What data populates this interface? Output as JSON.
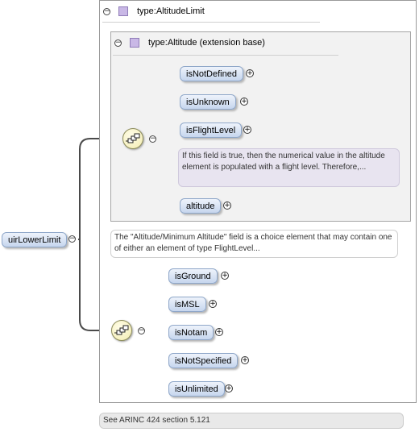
{
  "root": {
    "label": "uirLowerLimit",
    "toggle": "−"
  },
  "outer": {
    "header": "type:AltitudeLimit",
    "toggle": "−"
  },
  "inner": {
    "header": "type:Altitude (extension base)",
    "toggle": "−"
  },
  "choice1": {
    "toggle": "−",
    "items": [
      {
        "label": "isNotDefined",
        "expand": "+"
      },
      {
        "label": "isUnknown",
        "expand": "+"
      },
      {
        "label": "isFlightLevel",
        "expand": "+"
      },
      {
        "label": "altitude",
        "expand": "+"
      }
    ],
    "note": "If this field is true, then the numerical value in the altitude element is populated with a flight level. Therefore,..."
  },
  "choice_note": "The \"Altitude/Minimum Altitude\" field is a choice element that may contain one of either an element of type FlightLevel...",
  "choice2": {
    "toggle": "−",
    "items": [
      {
        "label": "isGround",
        "expand": "+"
      },
      {
        "label": "isMSL",
        "expand": "+"
      },
      {
        "label": "isNotam",
        "expand": "+"
      },
      {
        "label": "isNotSpecified",
        "expand": "+"
      },
      {
        "label": "isUnlimited",
        "expand": "+"
      }
    ]
  },
  "footer_note": "See ARINC 424 section 5.121",
  "colors": {
    "type_square": "#c9b8e6",
    "node_fill": "#c6d6ee",
    "choice_fill": "#f3ecb0",
    "connector": "#4a4a4a"
  }
}
